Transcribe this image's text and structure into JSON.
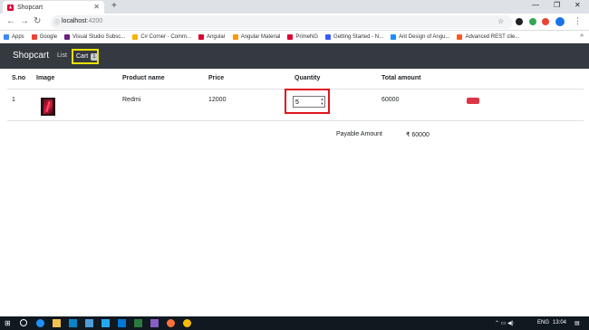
{
  "browser": {
    "tab_title": "Shopcart",
    "new_tab_symbol": "+",
    "address": {
      "host": "localhost",
      "port": ":4200"
    },
    "bookmarks": [
      {
        "label": "Apps",
        "color": "#4285f4"
      },
      {
        "label": "Google",
        "color": "#ea4335"
      },
      {
        "label": "Visual Studio Subsc...",
        "color": "#68217a"
      },
      {
        "label": "C# Corner - Comm...",
        "color": "#f4b400"
      },
      {
        "label": "Angular",
        "color": "#dd0031"
      },
      {
        "label": "Angular Material",
        "color": "#ff9800"
      },
      {
        "label": "PrimeNG",
        "color": "#dd0031"
      },
      {
        "label": "Getting Started - N...",
        "color": "#3d5afe"
      },
      {
        "label": "Ant Design of Angu...",
        "color": "#1890ff"
      },
      {
        "label": "Advanced REST clie...",
        "color": "#ff5722"
      }
    ],
    "bookmarks_more": "»"
  },
  "app": {
    "brand": "Shopcart",
    "nav_list": "List",
    "nav_cart": "Cart",
    "cart_count": "1"
  },
  "table": {
    "headers": [
      "S.no",
      "Image",
      "Product name",
      "Price",
      "Quantity",
      "Total amount"
    ],
    "rows": [
      {
        "sno": "1",
        "product": "Redmi",
        "price": "12000",
        "quantity": "5",
        "total": "60000"
      }
    ]
  },
  "summary": {
    "payable_label": "Payable Amount",
    "payable_value": "₹ 60000"
  },
  "taskbar": {
    "language": "ENG",
    "time": "13:04"
  },
  "colors": {
    "navbar_bg": "#343a40",
    "cart_highlight": "#e8e000",
    "quantity_highlight": "#e0141c",
    "delete_button": "#dc3545"
  }
}
